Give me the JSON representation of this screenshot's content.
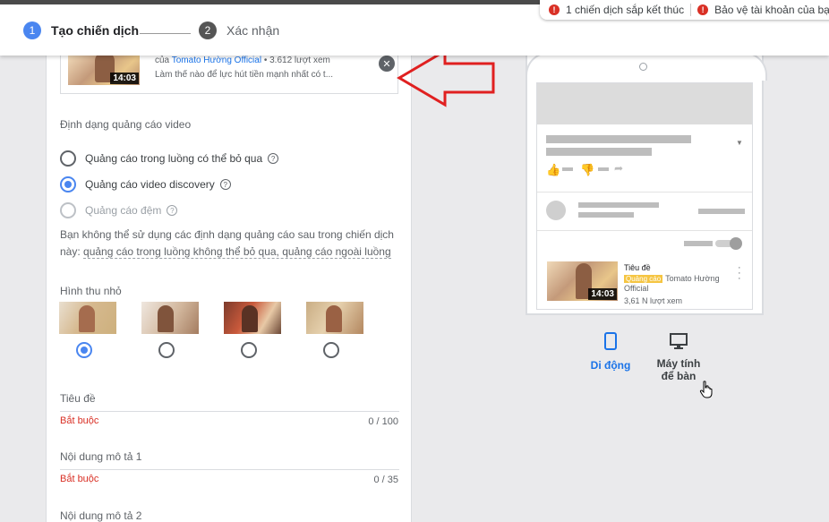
{
  "header": {
    "steps": [
      {
        "number": "1",
        "label": "Tạo chiến dịch"
      },
      {
        "number": "2",
        "label": "Xác nhận"
      }
    ]
  },
  "notifications": [
    {
      "icon": "!",
      "text": "1 chiến dịch sắp kết thúc"
    },
    {
      "icon": "!",
      "text": "Bảo vệ tài khoản của bạn k"
    }
  ],
  "video": {
    "meta_prefix": "của",
    "channel": "Tomato Hường Official",
    "views": "• 3.612 lượt xem",
    "description": "Làm thế nào để lực hút tiền mạnh nhất có t...",
    "duration": "14:03",
    "close_icon": "close-icon"
  },
  "format": {
    "label": "Định dạng quảng cáo video",
    "options": [
      {
        "label": "Quảng cáo trong luồng có thể bỏ qua",
        "checked": false,
        "disabled": false
      },
      {
        "label": "Quảng cáo video discovery",
        "checked": true,
        "disabled": false
      },
      {
        "label": "Quảng cáo đệm",
        "checked": false,
        "disabled": true
      }
    ],
    "notice_line1": "Bạn không thể sử dụng các định dạng quảng cáo sau trong chiến dịch",
    "notice_line2_prefix": "này:",
    "notice_line2_link": "quảng cáo trong luồng không thể bỏ qua, quảng cáo ngoài luồng"
  },
  "thumbnail": {
    "label": "Hình thu nhỏ",
    "selected_index": 0,
    "count": 4
  },
  "fields": [
    {
      "label": "Tiêu đề",
      "required": "Bắt buộc",
      "counter": "0 / 100"
    },
    {
      "label": "Nội dung mô tả 1",
      "required": "Bắt buộc",
      "counter": "0 / 35"
    },
    {
      "label": "Nội dung mô tả 2"
    }
  ],
  "preview": {
    "title": "Tiêu đề",
    "ad_badge": "Quảng cáo",
    "channel": "Tomato Hường Official",
    "views": "3,61 N lượt xem",
    "duration": "14:03"
  },
  "devices": [
    {
      "label": "Di động",
      "icon": "mobile-icon",
      "active": true
    },
    {
      "label_line1": "Máy tính",
      "label_line2": "để bàn",
      "icon": "desktop-icon",
      "active": false
    }
  ],
  "colors": {
    "accent": "#4a86f0",
    "link": "#1a73e8",
    "error": "#d93025",
    "annotation_arrow": "#e02020"
  }
}
